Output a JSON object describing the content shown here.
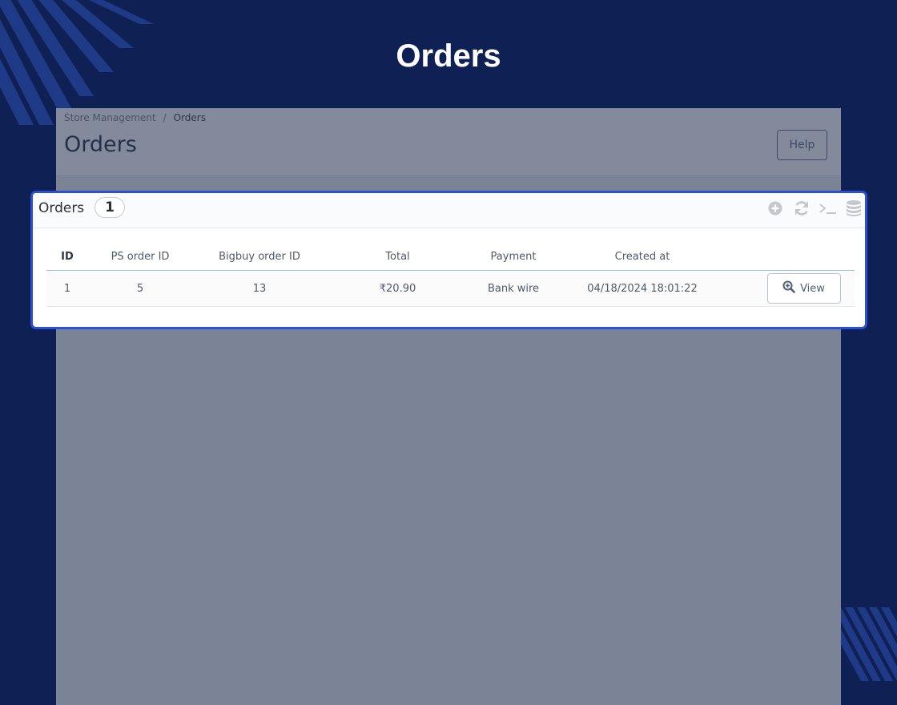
{
  "page_heading": "Orders",
  "breadcrumb": {
    "parent": "Store Management",
    "separator": "/",
    "current": "Orders"
  },
  "admin": {
    "title": "Orders",
    "help_label": "Help"
  },
  "panel": {
    "title": "Orders",
    "count": "1",
    "toolbar": [
      {
        "name": "add-new-icon",
        "icon": "plus-circle"
      },
      {
        "name": "refresh-icon",
        "icon": "refresh"
      },
      {
        "name": "sql-query-icon",
        "icon": "terminal"
      },
      {
        "name": "export-sql-icon",
        "icon": "database"
      }
    ]
  },
  "table": {
    "columns": [
      "ID",
      "PS order ID",
      "Bigbuy order ID",
      "Total",
      "Payment",
      "Created at",
      ""
    ],
    "rows": [
      {
        "id": "1",
        "ps_order_id": "5",
        "bigbuy_order_id": "13",
        "total": "₹20.90",
        "payment": "Bank wire",
        "created_at": "04/18/2024 18:01:22",
        "action_label": "View"
      }
    ]
  },
  "colors": {
    "page_background": "#0f2054",
    "panel_border": "#2d4fd6",
    "overlay": "#7b8396"
  }
}
